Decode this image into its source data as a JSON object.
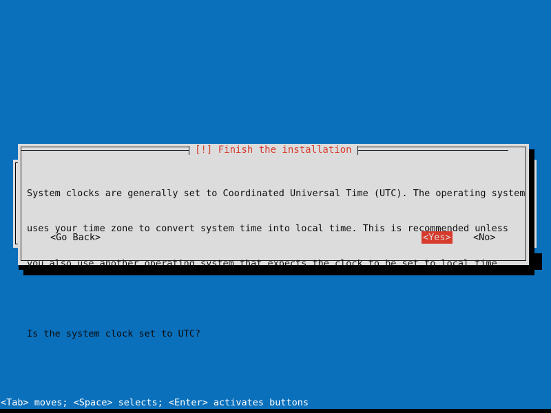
{
  "screen": {
    "background_color": "#0a70bc",
    "bottom_strip_color": "#000000"
  },
  "dialog": {
    "title": "[!] Finish the installation",
    "title_color": "#d83b2c",
    "background_color": "#dcdcdc",
    "border_color": "#1a1a1a",
    "body_lines": [
      "System clocks are generally set to Coordinated Universal Time (UTC). The operating system",
      "uses your time zone to convert system time into local time. This is recommended unless",
      "you also use another operating system that expects the clock to be set to local time."
    ],
    "question": "Is the system clock set to UTC?",
    "buttons": [
      {
        "label": "<Go Back>",
        "selected": false
      },
      {
        "label": "<Yes>",
        "selected": true
      },
      {
        "label": "<No>",
        "selected": false
      }
    ],
    "selected_button_bg": "#d83b2c",
    "selected_button_fg": "#dcdcdc"
  },
  "help_bar": {
    "text": "<Tab> moves; <Space> selects; <Enter> activates buttons",
    "text_color": "#ffffff"
  }
}
